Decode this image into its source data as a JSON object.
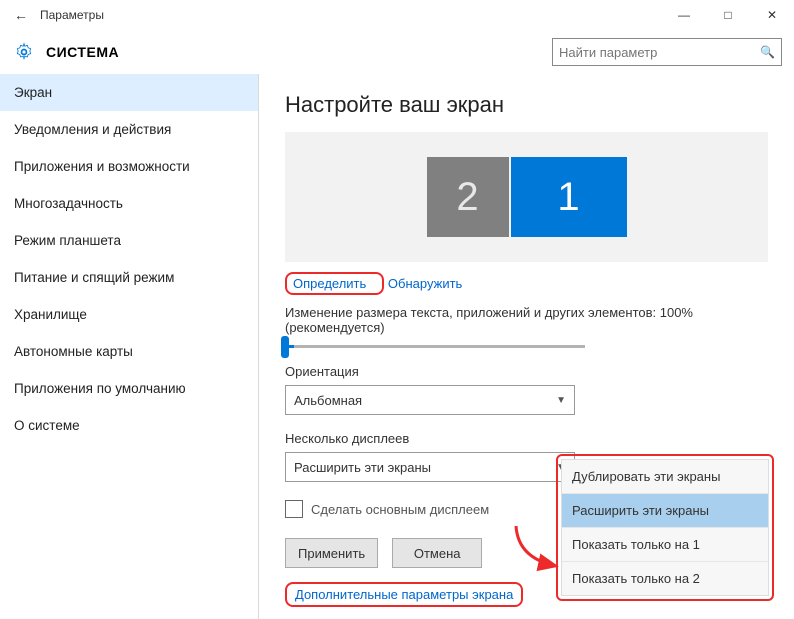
{
  "window": {
    "title": "Параметры",
    "section": "СИСТЕМА"
  },
  "search": {
    "placeholder": "Найти параметр"
  },
  "sidebar": {
    "items": [
      {
        "label": "Экран",
        "active": true
      },
      {
        "label": "Уведомления и действия",
        "active": false
      },
      {
        "label": "Приложения и возможности",
        "active": false
      },
      {
        "label": "Многозадачность",
        "active": false
      },
      {
        "label": "Режим планшета",
        "active": false
      },
      {
        "label": "Питание и спящий режим",
        "active": false
      },
      {
        "label": "Хранилище",
        "active": false
      },
      {
        "label": "Автономные карты",
        "active": false
      },
      {
        "label": "Приложения по умолчанию",
        "active": false
      },
      {
        "label": "О системе",
        "active": false
      }
    ]
  },
  "main": {
    "title": "Настройте ваш экран",
    "displays": {
      "d1": "1",
      "d2": "2"
    },
    "identify_label": "Определить",
    "detect_label": "Обнаружить",
    "scale_text": "Изменение размера текста, приложений и других элементов: 100% (рекомендуется)",
    "orientation_label": "Ориентация",
    "orientation_value": "Альбомная",
    "multidisp_label": "Несколько дисплеев",
    "multidisp_value": "Расширить эти экраны",
    "make_primary_label": "Сделать основным дисплеем",
    "apply_label": "Применить",
    "cancel_label": "Отмена",
    "advanced_link": "Дополнительные параметры экрана"
  },
  "popup": {
    "options": [
      {
        "label": "Дублировать эти экраны",
        "selected": false
      },
      {
        "label": "Расширить эти экраны",
        "selected": true
      },
      {
        "label": "Показать только на 1",
        "selected": false
      },
      {
        "label": "Показать только на 2",
        "selected": false
      }
    ]
  }
}
